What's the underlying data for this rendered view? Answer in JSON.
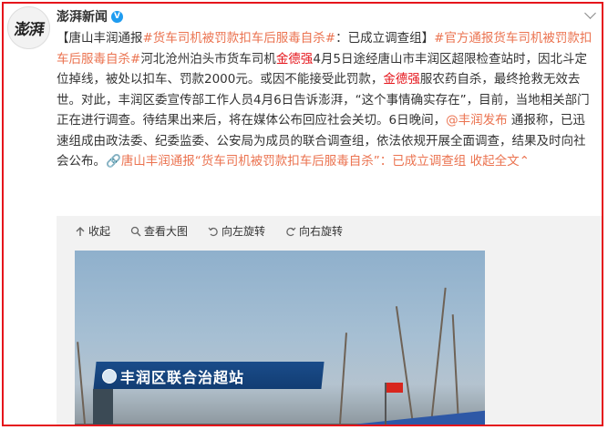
{
  "avatar": {
    "text": "澎湃"
  },
  "author": {
    "name": "澎湃新闻",
    "verified_icon": "verified-v-icon"
  },
  "post": {
    "s1": "【唐山丰润通报",
    "s2": "#货车司机被罚款扣车后服毒自杀#",
    "s3": "：已成立调查组】",
    "s4": "#官方通报货车司机被罚款扣车后服毒自杀#",
    "s5": "河北沧州泊头市货车司机",
    "s6": "金德强",
    "s7": "4月5日途经唐山市丰润区超限检查站时，因北斗定位掉线，被处以扣车、罚款2000元。或因不能接受此罚款，",
    "s8": "金德强",
    "s9": "服农药自杀，最终抢救无效去世。对此，丰润区委宣传部工作人员4月6日告诉澎湃，“这个事情确实存在”，目前，当地相关部门正在进行调查。待结果出来后，将在媒体公布回应社会关切。6日晚间，",
    "s10": "@丰润发布",
    "s11": " 通报称，已迅速组成由政法委、纪委监委、公安局为成员的联合调查组，依法依规开展全面调查，结果及时向社会公布。",
    "s12": "唐山丰润通报“货车司机被罚款扣车后服毒自杀”：已成立调查组",
    "s13": " 收起全文",
    "s14": "⌃"
  },
  "media_toolbar": {
    "collapse": "收起",
    "view_large": "查看大图",
    "rotate_left": "向左旋转",
    "rotate_right": "向右旋转"
  },
  "photo": {
    "sign": "丰润区联合治超站"
  },
  "colors": {
    "frame": "#e5151b",
    "link": "#eb7350",
    "highlight": "#e5151b",
    "verified": "#1f9cf0"
  }
}
